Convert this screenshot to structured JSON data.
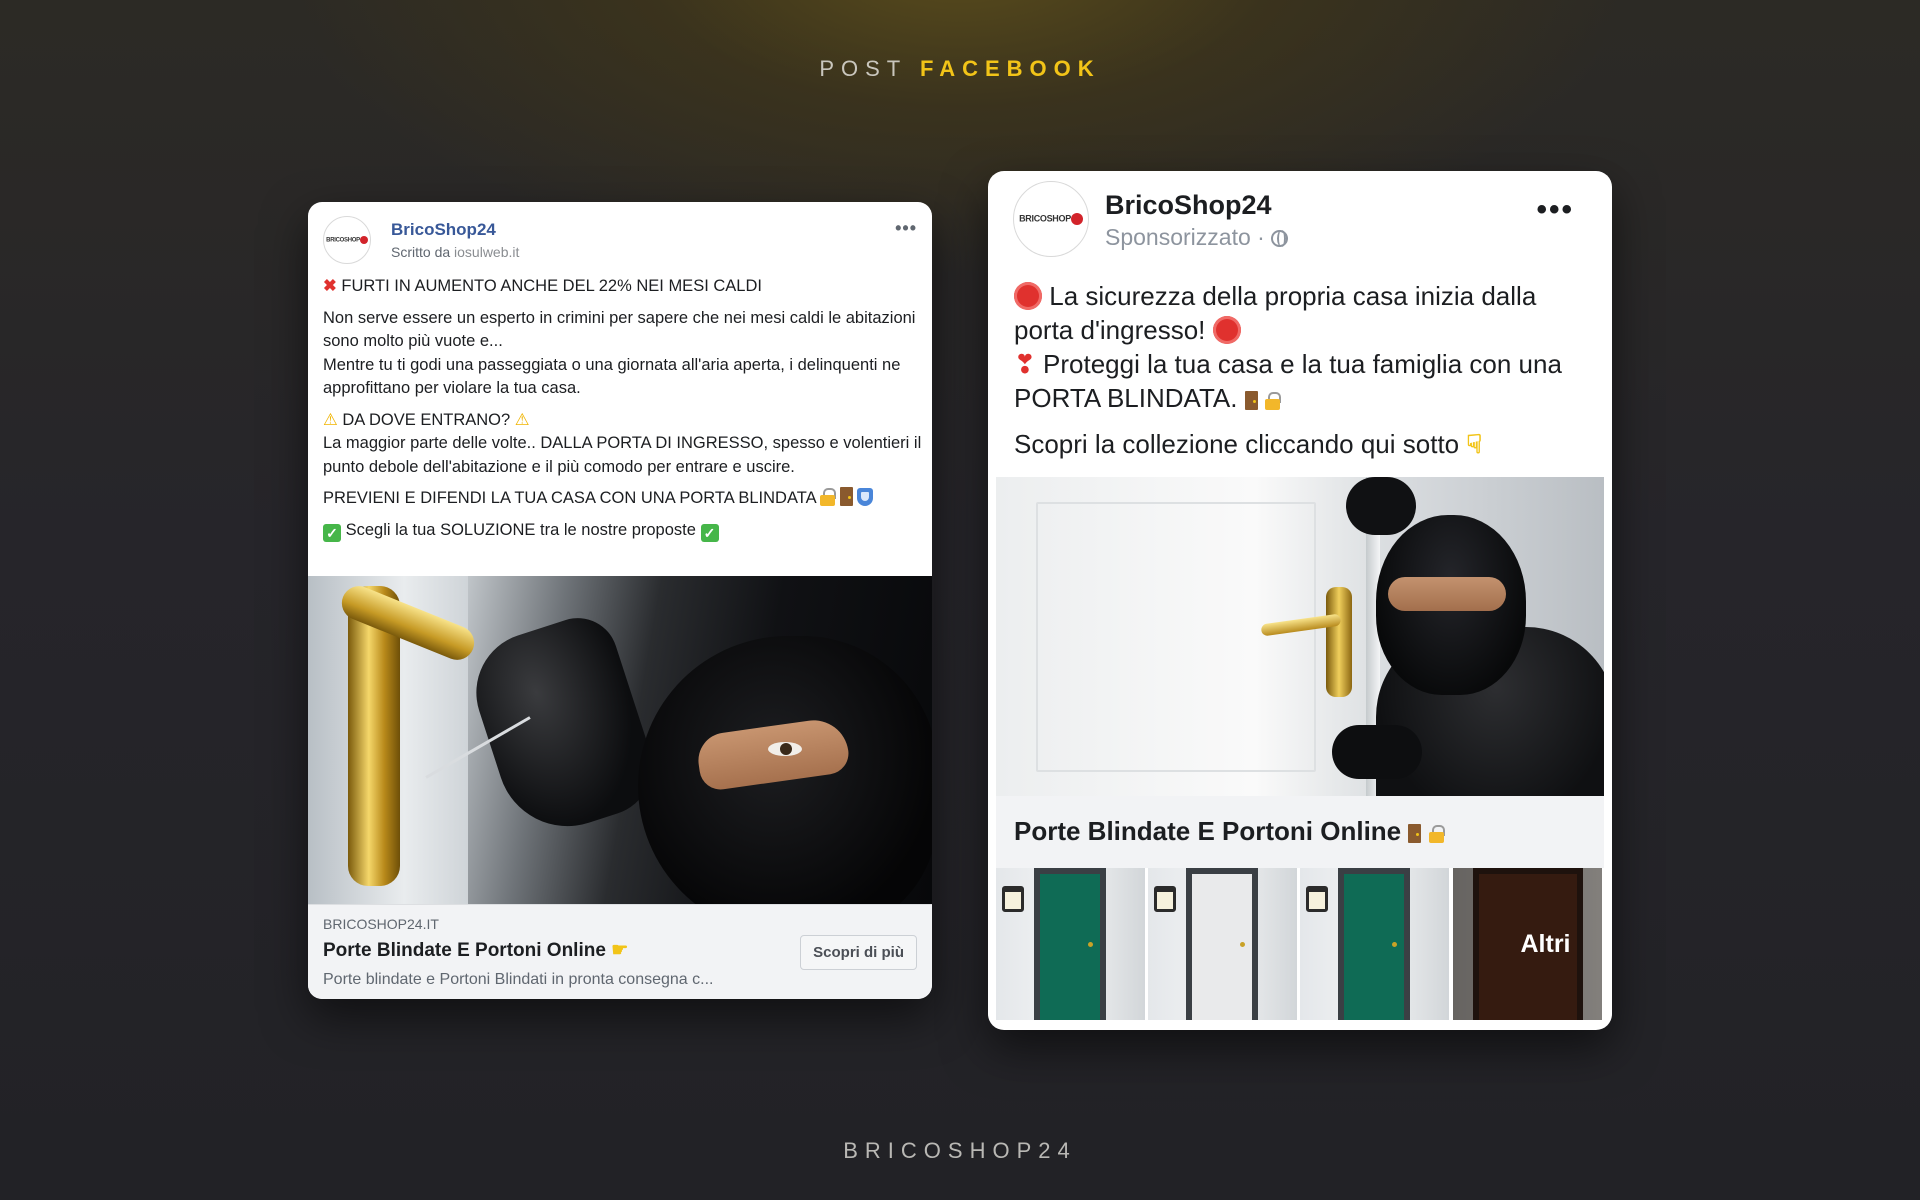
{
  "headline": {
    "prefix": "POST",
    "accent": "FACEBOOK"
  },
  "footer_brand": "BRICOSHOP24",
  "colors": {
    "accent": "#f2c418",
    "facebook_link": "#385898",
    "background": "#26252a"
  },
  "card1": {
    "logo_text": "BRICOSHOP",
    "page_name": "BricoShop24",
    "byline_prefix": "Scritto da",
    "byline_source": "iosulweb.it",
    "more_icon": "ellipsis-icon",
    "headline": "FURTI IN AUMENTO ANCHE DEL 22% NEI MESI CALDI",
    "para1": "Non serve essere un esperto in crimini per sapere che nei mesi caldi le abitazioni sono molto più vuote e...",
    "para2": "Mentre tu ti godi una passeggiata o una giornata all'aria aperta, i delinquenti ne approfittano per violare la tua casa.",
    "question": "DA DOVE ENTRANO?",
    "para3": "La maggior parte delle volte.. DALLA PORTA DI INGRESSO, spesso e volentieri il punto debole dell'abitazione e il più comodo per entrare e uscire.",
    "para4": "PREVIENI E DIFENDI LA TUA CASA CON UNA PORTA BLINDATA",
    "para5": "Scegli la tua SOLUZIONE tra le nostre proposte",
    "image_alt": "burglar-picking-door-lock",
    "link_domain": "BRICOSHOP24.IT",
    "link_title": "Porte Blindate E Portoni Online",
    "link_desc": "Porte blindate e Portoni Blindati in pronta consegna c...",
    "cta_label": "Scopri di più"
  },
  "card2": {
    "logo_text": "BRICOSHOP",
    "page_name": "BricoShop24",
    "sponsored": "Sponsorizzato ·",
    "more_icon": "ellipsis-icon",
    "line1": "La sicurezza della propria casa inizia dalla porta d'ingresso!",
    "line2": "Proteggi la tua casa e la tua famiglia con una PORTA BLINDATA.",
    "line3": "Scopri la collezione cliccando qui sotto",
    "image_alt": "burglar-behind-white-door",
    "link_title": "Porte Blindate E Portoni Online",
    "thumbs": [
      {
        "door_color": "#0f6b55"
      },
      {
        "door_color": "#e9eaeb"
      },
      {
        "door_color": "#0f6b55"
      },
      {
        "door_color": "#4a2617",
        "overlay": "Altri"
      }
    ]
  }
}
